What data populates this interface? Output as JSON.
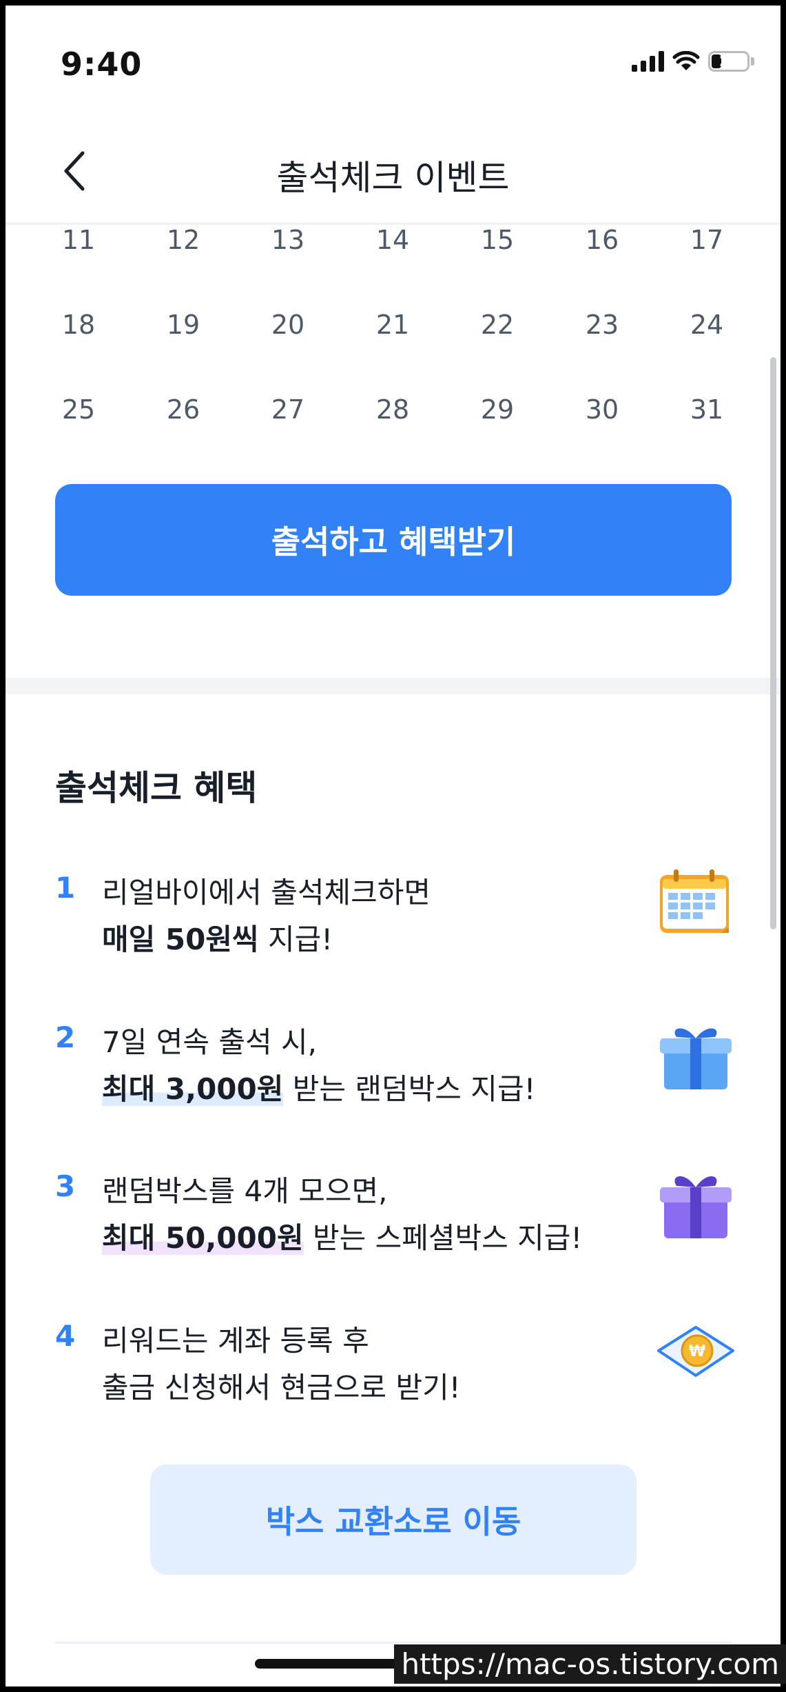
{
  "status_bar": {
    "time": "9:40",
    "battery": "25"
  },
  "header": {
    "title": "출석체크 이벤트"
  },
  "calendar": {
    "weeks": [
      [
        "11",
        "12",
        "13",
        "14",
        "15",
        "16",
        "17"
      ],
      [
        "18",
        "19",
        "20",
        "21",
        "22",
        "23",
        "24"
      ],
      [
        "25",
        "26",
        "27",
        "28",
        "29",
        "30",
        "31"
      ]
    ]
  },
  "attend_button": {
    "label": "출석하고 혜택받기"
  },
  "benefits": {
    "title": "출석체크 혜택",
    "items": [
      {
        "number": "1",
        "line1": "리얼바이에서 출석체크하면",
        "line2_bold": "매일 50원씩",
        "line2_rest": " 지급!",
        "icon": "calendar-icon"
      },
      {
        "number": "2",
        "line1": "7일 연속 출석 시,",
        "line2_bold": "최대 3,000원",
        "line2_rest": " 받는 랜덤박스 지급!",
        "icon": "blue-gift-icon"
      },
      {
        "number": "3",
        "line1": "랜덤박스를 4개 모으면,",
        "line2_bold": "최대 50,000원",
        "line2_rest": " 받는 스페셜박스 지급!",
        "icon": "purple-gift-icon"
      },
      {
        "number": "4",
        "line1": "리워드는 계좌 등록 후",
        "line2_bold": "",
        "line2_rest": "출금 신청해서 현금으로 받기!",
        "icon": "won-coin-icon"
      }
    ]
  },
  "exchange_button": {
    "label": "박스 교환소로 이동"
  },
  "watermark": "https://mac-os.tistory.com",
  "colors": {
    "primary": "#3182f6",
    "primary_light": "#e3efff",
    "text": "#191f28",
    "sub_text": "#4e5968"
  }
}
